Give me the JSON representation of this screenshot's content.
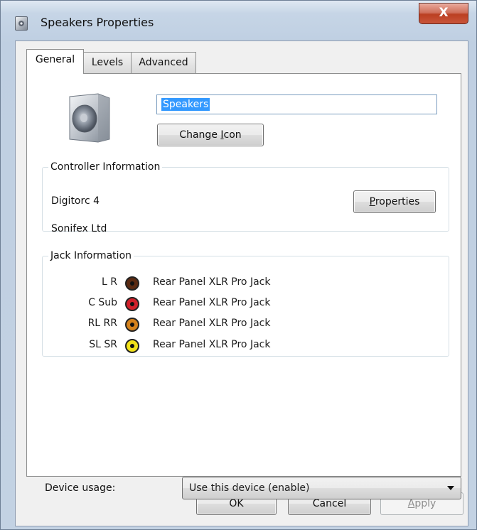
{
  "window": {
    "title": "Speakers Properties",
    "close_label": "X",
    "icon": "speaker-properties-icon"
  },
  "tabs": [
    {
      "label": "General",
      "active": true
    },
    {
      "label": "Levels",
      "active": false
    },
    {
      "label": "Advanced",
      "active": false
    }
  ],
  "general": {
    "device_name": "Speakers",
    "device_icon": "speaker-icon",
    "change_icon": {
      "before": "Change ",
      "accel": "I",
      "after": "con"
    },
    "controller": {
      "legend": "Controller Information",
      "name": "Digitorc 4",
      "vendor": "Sonifex Ltd",
      "properties_button": {
        "accel": "P",
        "after": "roperties"
      }
    },
    "jacks": {
      "legend": "Jack Information",
      "rows": [
        {
          "channels": "L R",
          "color": "#5a2a12",
          "description": "Rear Panel XLR Pro Jack"
        },
        {
          "channels": "C Sub",
          "color": "#d0202a",
          "description": "Rear Panel XLR Pro Jack"
        },
        {
          "channels": "RL RR",
          "color": "#d5821c",
          "description": "Rear Panel XLR Pro Jack"
        },
        {
          "channels": "SL SR",
          "color": "#f2e21a",
          "description": "Rear Panel XLR Pro Jack"
        }
      ]
    },
    "device_usage": {
      "label": "Device usage:",
      "selected": "Use this device (enable)"
    }
  },
  "buttons": {
    "ok": "OK",
    "cancel": "Cancel",
    "apply": {
      "accel": "A",
      "after": "pply",
      "enabled": false
    }
  }
}
